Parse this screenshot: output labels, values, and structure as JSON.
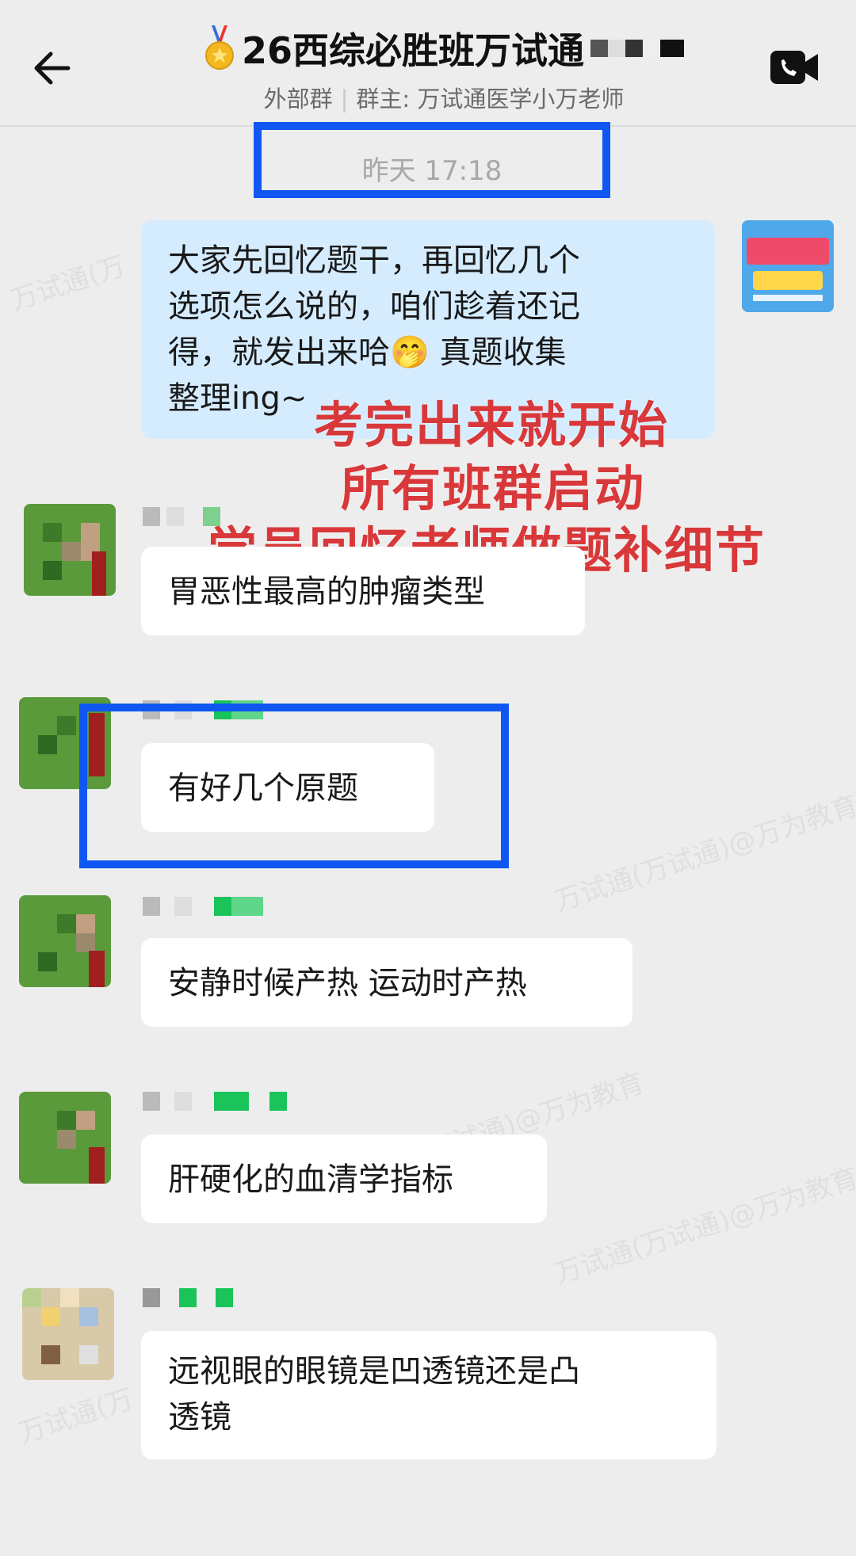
{
  "header": {
    "title": "26西综必胜班万试通",
    "group_type": "外部群",
    "owner": "群主: 万试通医学小万老师",
    "back_icon": "back-arrow-icon",
    "video_icon": "video-call-icon"
  },
  "timestamp": "昨天  17:18",
  "self_message": {
    "text_line1": "大家先回忆题干，再回忆几个",
    "text_line2": "选项怎么说的，咱们趁着还记",
    "text_line3": "得，就发出来哈",
    "text_line3b": " 真题收集",
    "text_line4": "整理ing~",
    "emoji": "🤭"
  },
  "overlay": {
    "line1": "考完出来就开始",
    "line2": "所有班群启动",
    "line3": "学员回忆老师做题补细节"
  },
  "messages": [
    {
      "text": "胃恶性最高的肿瘤类型"
    },
    {
      "text": "有好几个原题"
    },
    {
      "text": "安静时候产热 运动时产热"
    },
    {
      "text": "肝硬化的血清学指标"
    },
    {
      "text_line1": "远视眼的眼镜是凹透镜还是凸",
      "text_line2": "透镜"
    }
  ],
  "colors": {
    "background": "#ededed",
    "highlight": "#0f57f0",
    "overlay_red": "#d9383a",
    "self_bubble": "#d5ecff"
  }
}
